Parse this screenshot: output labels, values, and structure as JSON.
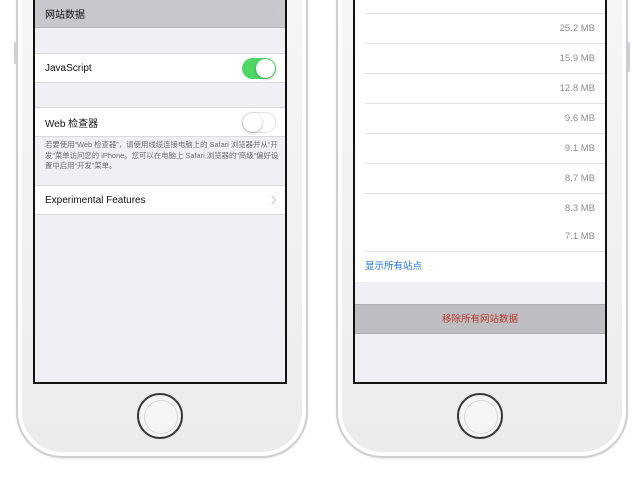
{
  "left_screen": {
    "website_data": {
      "label": "网站数据"
    },
    "javascript": {
      "label": "JavaScript",
      "enabled": true
    },
    "web_inspector": {
      "label": "Web 检查器",
      "enabled": false,
      "footnote": "若要使用“Web 检查器”，请使用线缆连接电脑上的 Safari 浏览器并从“开发”菜单访问您的 iPhone。您可以在电脑上 Safari 浏览器的“高级”偏好设置中启用“开发”菜单。"
    },
    "experimental": {
      "label": "Experimental Features"
    }
  },
  "right_screen": {
    "sizes": [
      "25.2 MB",
      "15.9 MB",
      "12.8 MB",
      "9.6 MB",
      "9.1 MB",
      "8.7 MB",
      "8.3 MB",
      "7.1 MB"
    ],
    "show_all_label": "显示所有站点",
    "remove_all_label": "移除所有网站数据"
  },
  "colors": {
    "toggle_on": "#4cd964",
    "link_blue": "#1a73e8",
    "destructive": "#b53a2d"
  }
}
